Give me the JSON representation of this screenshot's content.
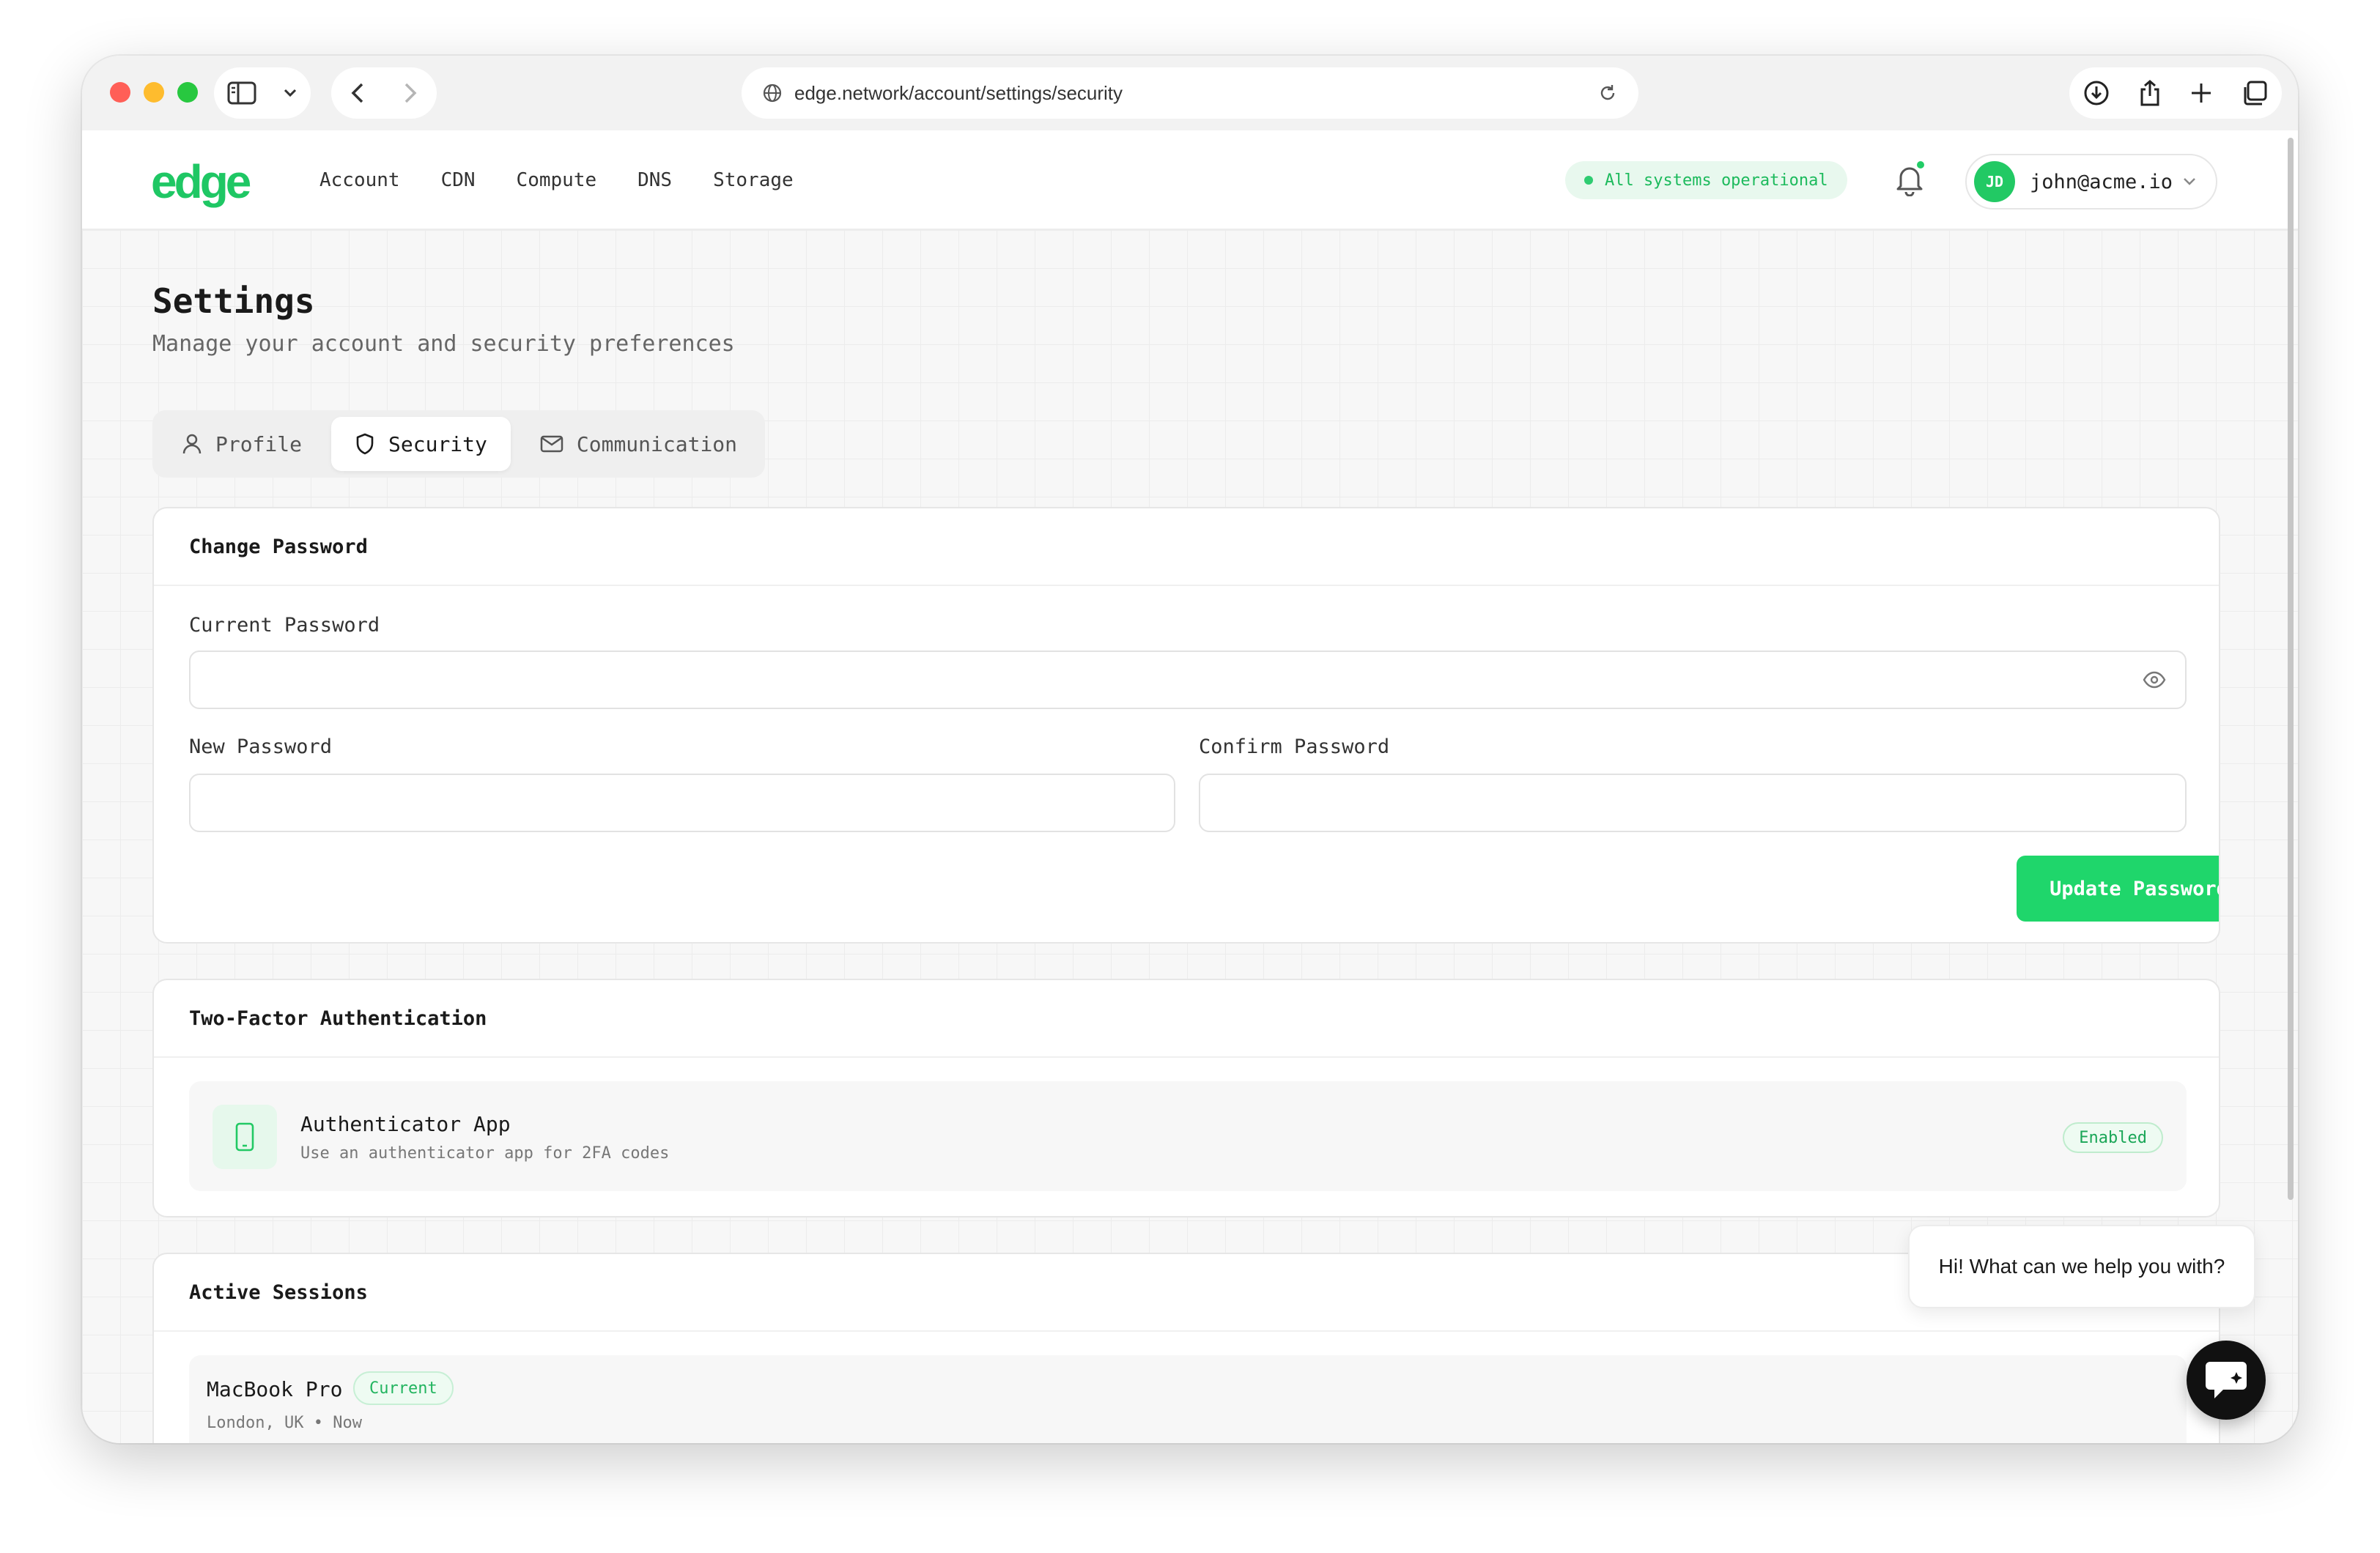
{
  "browser": {
    "url": "edge.network/account/settings/security"
  },
  "header": {
    "logo": "edge",
    "nav": [
      "Account",
      "CDN",
      "Compute",
      "DNS",
      "Storage"
    ],
    "status": "All systems operational",
    "user": {
      "initials": "JD",
      "email": "john@acme.io"
    }
  },
  "page": {
    "title": "Settings",
    "subtitle": "Manage your account and security preferences",
    "tabs": [
      {
        "label": "Profile",
        "icon": "user-icon"
      },
      {
        "label": "Security",
        "icon": "shield-icon",
        "active": true
      },
      {
        "label": "Communication",
        "icon": "mail-icon"
      }
    ]
  },
  "change_password": {
    "title": "Change Password",
    "current_label": "Current Password",
    "new_label": "New Password",
    "confirm_label": "Confirm Password",
    "current_value": "",
    "new_value": "",
    "confirm_value": "",
    "button": "Update Password"
  },
  "two_factor": {
    "title": "Two-Factor Authentication",
    "method": "Authenticator App",
    "description": "Use an authenticator app for 2FA codes",
    "status": "Enabled"
  },
  "sessions": {
    "title": "Active Sessions",
    "items": [
      {
        "device": "MacBook Pro",
        "badge": "Current",
        "location": "London, UK",
        "time": "Now"
      }
    ]
  },
  "chat": {
    "greeting": "Hi! What can we help you with?"
  },
  "colors": {
    "accent": "#1fd66b",
    "brand": "#1fc764",
    "status_bg": "#e8f8ee"
  }
}
